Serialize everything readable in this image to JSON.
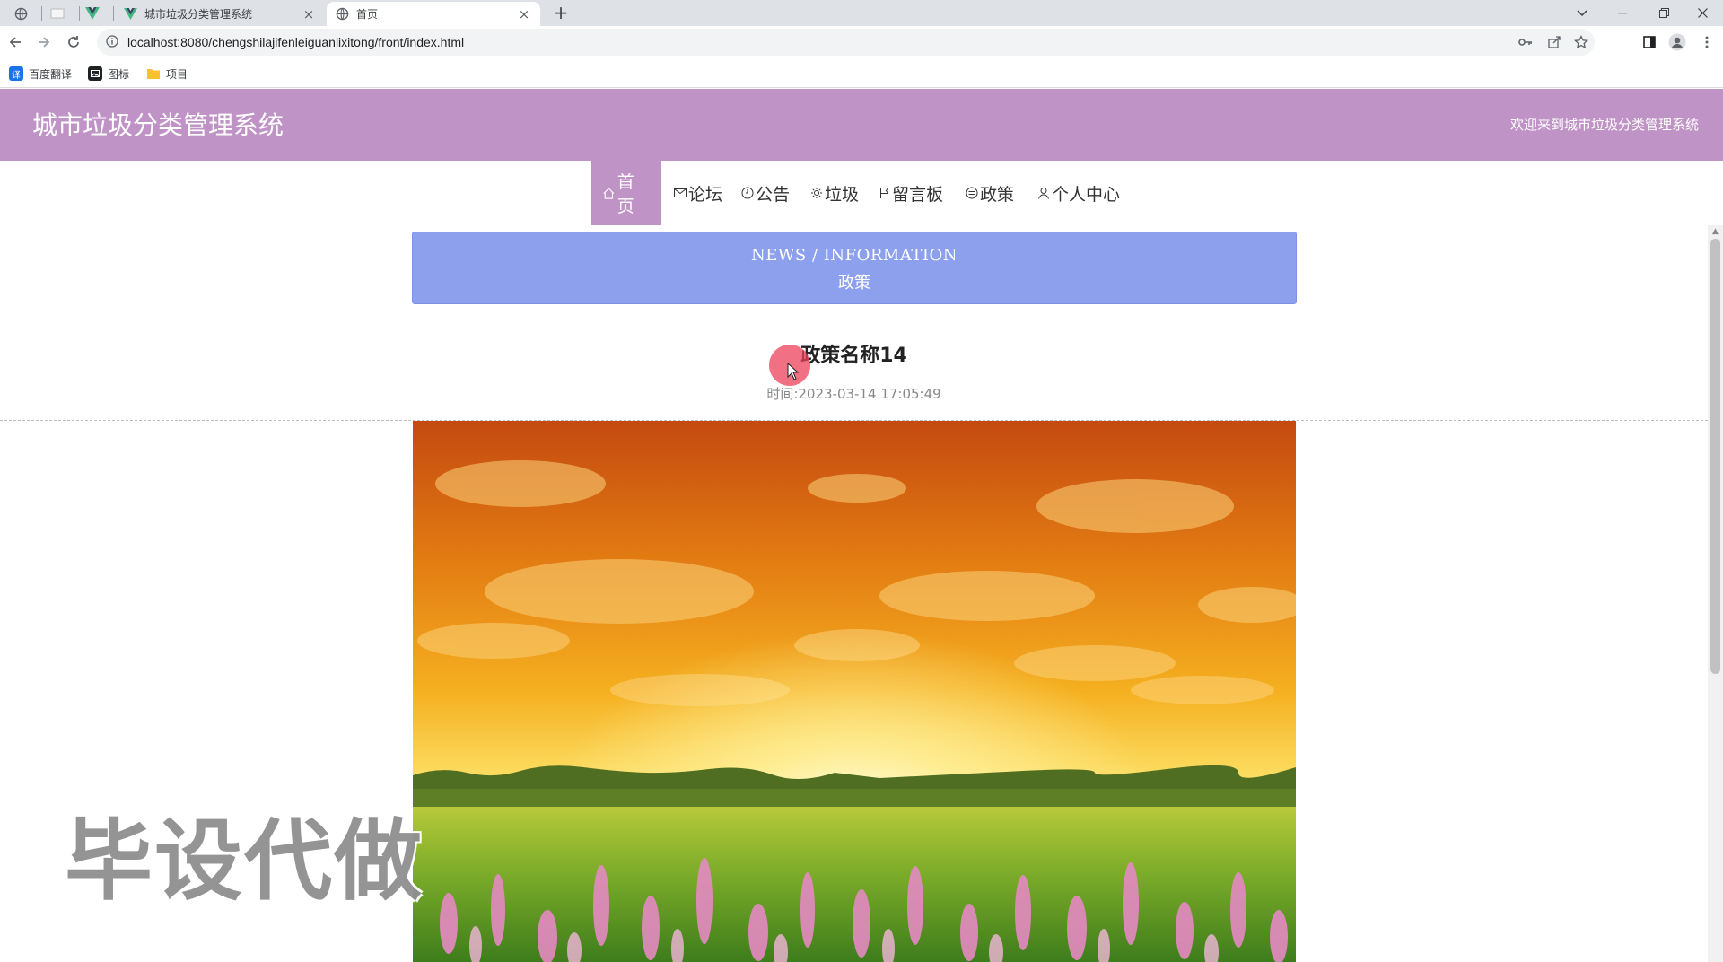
{
  "browser": {
    "tabs": [
      {
        "title": "城市垃圾分类管理系统",
        "favicon": "vue-icon"
      },
      {
        "title": "首页",
        "favicon": "globe-icon"
      }
    ],
    "url": "localhost:8080/chengshilajifenleiguanlixitong/front/index.html",
    "bookmarks": [
      {
        "label": "百度翻译",
        "icon": "translate-icon",
        "color": "#1a73e8"
      },
      {
        "label": "图标",
        "icon": "image-icon",
        "color": "#202124"
      },
      {
        "label": "项目",
        "icon": "folder-icon",
        "color": "#fbc02d"
      }
    ]
  },
  "header": {
    "title": "城市垃圾分类管理系统",
    "welcome": "欢迎来到城市垃圾分类管理系统",
    "color": "#c093c6"
  },
  "nav": {
    "items": [
      {
        "label": "首页",
        "icon": "home-icon"
      },
      {
        "label": "论坛",
        "icon": "mail-icon"
      },
      {
        "label": "公告",
        "icon": "clock-icon"
      },
      {
        "label": "垃圾",
        "icon": "gear-icon"
      },
      {
        "label": "留言板",
        "icon": "flag-icon"
      },
      {
        "label": "政策",
        "icon": "list-icon"
      },
      {
        "label": "个人中心",
        "icon": "user-icon"
      }
    ],
    "active_index": 0
  },
  "banner": {
    "title_en": "NEWS / INFORMATION",
    "title_cn": "政策",
    "color": "#8ca0ee"
  },
  "article": {
    "title": "政策名称14",
    "time_label": "时间:",
    "time_value": "2023-03-14 17:05:49"
  },
  "watermark": "毕设代做"
}
